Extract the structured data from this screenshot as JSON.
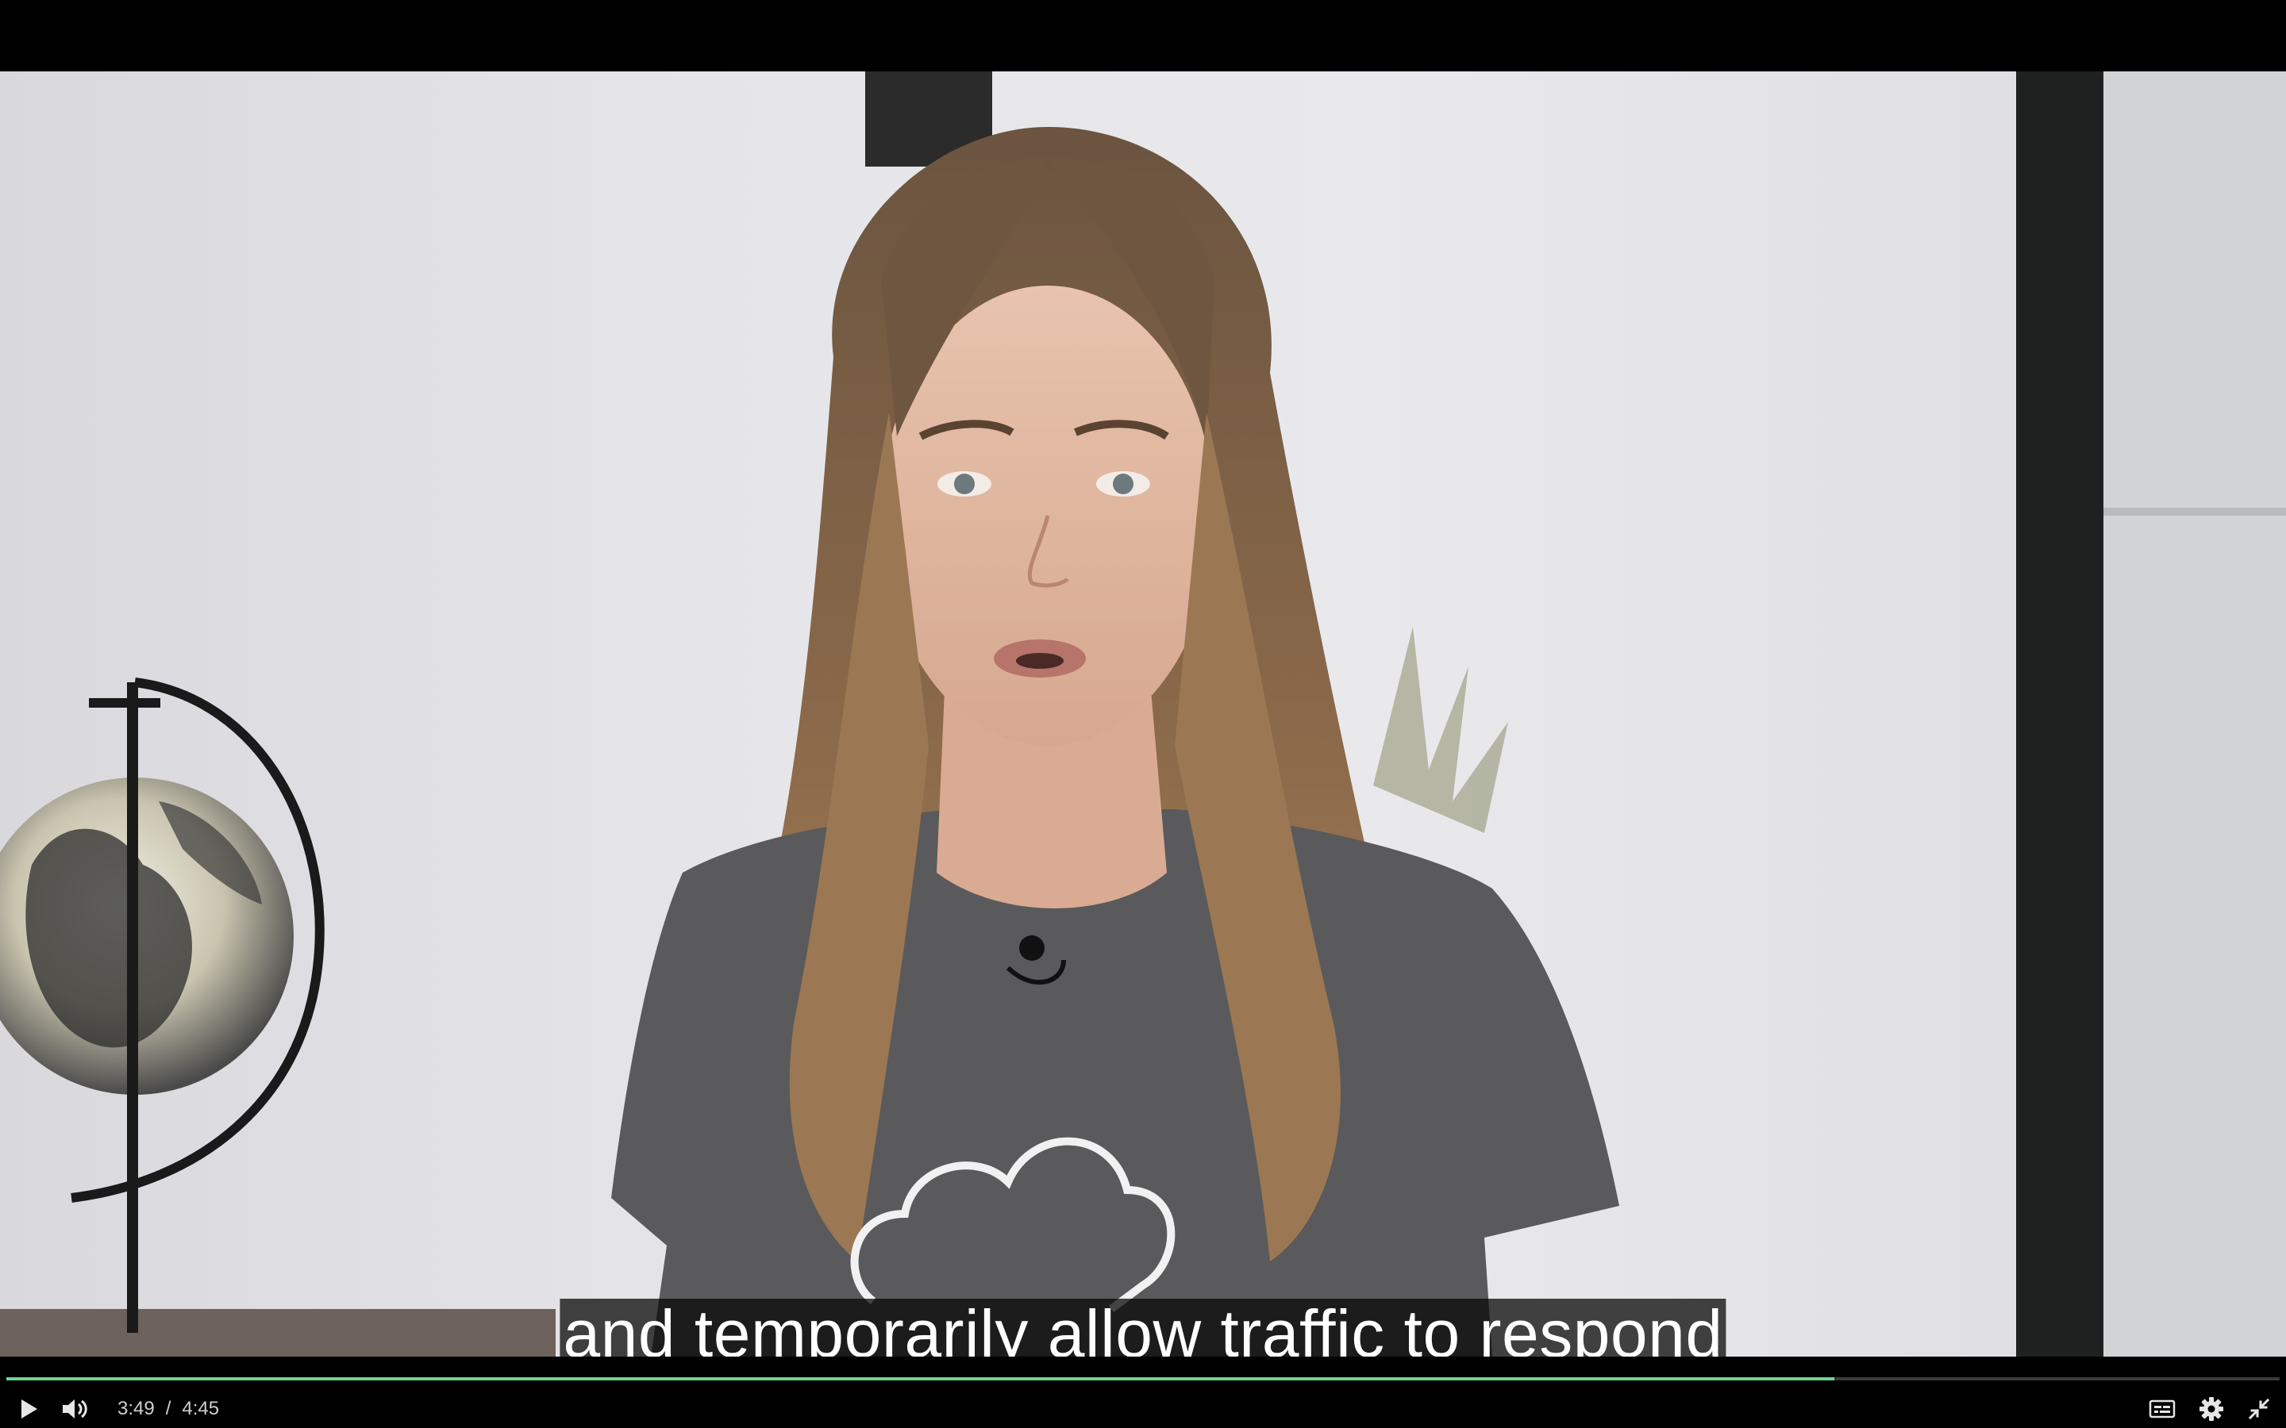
{
  "subtitle": "and temporarily allow traffic to respond",
  "player": {
    "current_time": "3:49",
    "separator": "/",
    "duration": "4:45",
    "progress": 0.804,
    "accent_color": "#6fd68f"
  },
  "icons": {
    "play": "play-icon",
    "volume": "volume-icon",
    "captions": "captions-icon",
    "settings": "gear-icon",
    "exit_fullscreen": "exit-fullscreen-icon"
  }
}
